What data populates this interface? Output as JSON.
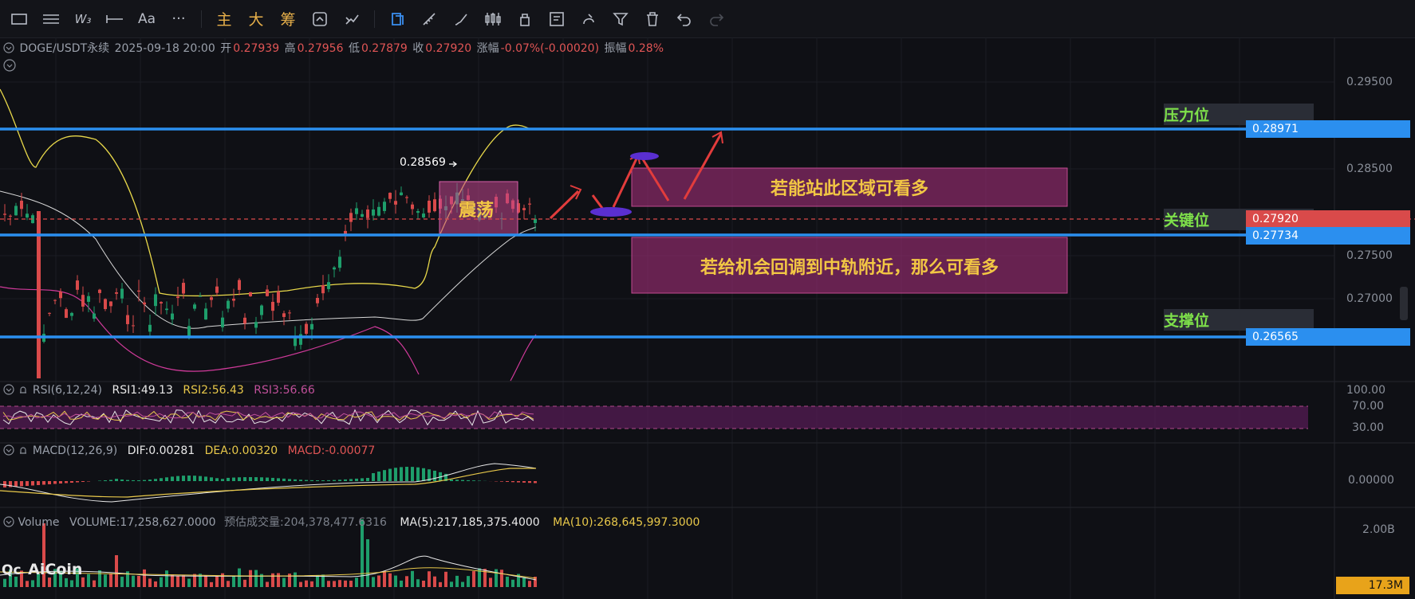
{
  "toolbar": {
    "items": [
      {
        "name": "rectangle-tool-icon",
        "glyph": "▭"
      },
      {
        "name": "horizontal-lines-tool-icon",
        "glyph": "☰"
      },
      {
        "name": "wave-pattern-tool-icon",
        "glyph": "W₃"
      },
      {
        "name": "line-tool-icon",
        "glyph": "⊢"
      },
      {
        "name": "text-tool-icon",
        "glyph": "Aa"
      },
      {
        "name": "more-tools-icon",
        "glyph": "···"
      }
    ],
    "chinese_items": [
      {
        "name": "main-indicator-button",
        "label": "主"
      },
      {
        "name": "big-period-button",
        "label": "大"
      },
      {
        "name": "chip-distribution-button",
        "label": "筹"
      }
    ],
    "right_items": [
      {
        "name": "refresh-icon",
        "glyph": "⟳",
        "active": false
      },
      {
        "name": "share-icon",
        "glyph": "⤲",
        "active": false
      },
      {
        "name": "magnet-icon",
        "glyph": "⧉",
        "active": true
      },
      {
        "name": "ruler-icon",
        "glyph": "✎",
        "active": false
      },
      {
        "name": "brush-icon",
        "glyph": "✐",
        "active": false
      },
      {
        "name": "candlestick-icon",
        "glyph": "▥",
        "active": false
      },
      {
        "name": "lock-icon",
        "glyph": "⊡",
        "active": false
      },
      {
        "name": "note-icon",
        "glyph": "✍",
        "active": false
      },
      {
        "name": "draw-icon",
        "glyph": "⎈",
        "active": false
      },
      {
        "name": "filter-icon",
        "glyph": "⏚",
        "active": false
      },
      {
        "name": "trash-icon",
        "glyph": "🗑",
        "active": false
      },
      {
        "name": "undo-icon",
        "glyph": "↶",
        "active": false
      },
      {
        "name": "redo-icon",
        "glyph": "↷",
        "active": false
      }
    ]
  },
  "ticker": {
    "symbol": "DOGE/USDT永续",
    "datetime": "2025-09-18 20:00",
    "open_label": "开",
    "open": "0.27939",
    "high_label": "高",
    "high": "0.27956",
    "low_label": "低",
    "low": "0.27879",
    "close_label": "收",
    "close": "0.27920",
    "change_label": "涨幅",
    "change": "-0.07%(-0.00020)",
    "amp_label": "振幅",
    "amp": "0.28%"
  },
  "price_axis": {
    "ticks": [
      "0.29500",
      "0.28500",
      "0.27500",
      "0.27000"
    ],
    "labels": [
      {
        "text": "0.28971",
        "color": "#2b8fef"
      },
      {
        "text": "0.27920",
        "color": "#d94a4a"
      },
      {
        "text": "0.27734",
        "color": "#2b8fef"
      },
      {
        "text": "0.26565",
        "color": "#2b8fef"
      }
    ]
  },
  "levels": {
    "resistance": "压力位",
    "key": "关键位",
    "support": "支撑位"
  },
  "annotations": {
    "range": "震荡",
    "peak": "0.28569",
    "upper_box": "若能站此区域可看多",
    "lower_box": "若给机会回调到中轨附近，那么可看多"
  },
  "rsi": {
    "title": "RSI(6,12,24)",
    "rsi1": "RSI1:49.13",
    "rsi2": "RSI2:56.43",
    "rsi3": "RSI3:56.66",
    "ticks": [
      "100.00",
      "70.00",
      "30.00"
    ]
  },
  "macd": {
    "title": "MACD(12,26,9)",
    "dif": "DIF:0.00281",
    "dea": "DEA:0.00320",
    "macd": "MACD:-0.00077",
    "ticks": [
      "0.00000"
    ]
  },
  "volume": {
    "title": "Volume",
    "volume": "VOLUME:17,258,627.0000",
    "estimate": "预估成交量:204,378,477.6316",
    "ma5": "MA(5):217,185,375.4000",
    "ma10": "MA(10):268,645,997.3000",
    "ticks": [
      "2.00B"
    ],
    "current": "17.3M"
  },
  "logo": "AiCoin",
  "colors": {
    "accent_blue": "#2b8fef",
    "up": "#1e9e6b",
    "down": "#d94a4a",
    "annotation_yellow": "#f2c744",
    "level_green": "#7ee04a"
  }
}
